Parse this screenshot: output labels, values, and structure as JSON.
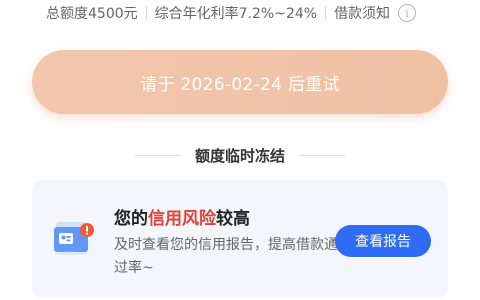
{
  "info": {
    "total_quota": "总额度4500元",
    "rate": "综合年化利率7.2%~24%",
    "notice": "借款须知",
    "info_icon": "i"
  },
  "retry_button": {
    "label": "请于 2026-02-24 后重试"
  },
  "status": {
    "title": "额度临时冻结"
  },
  "credit_card": {
    "title_prefix": "您的",
    "title_highlight": "信用风险",
    "title_suffix": "较高",
    "description": "及时查看您的信用报告，提高借款通过率~",
    "report_button": "查看报告",
    "icon": "credit-report-icon"
  },
  "colors": {
    "retry_button": "#f1c4a9",
    "highlight": "#e5403a",
    "report_button": "#2f6cf6",
    "card_bg": "#f4f6fb"
  }
}
